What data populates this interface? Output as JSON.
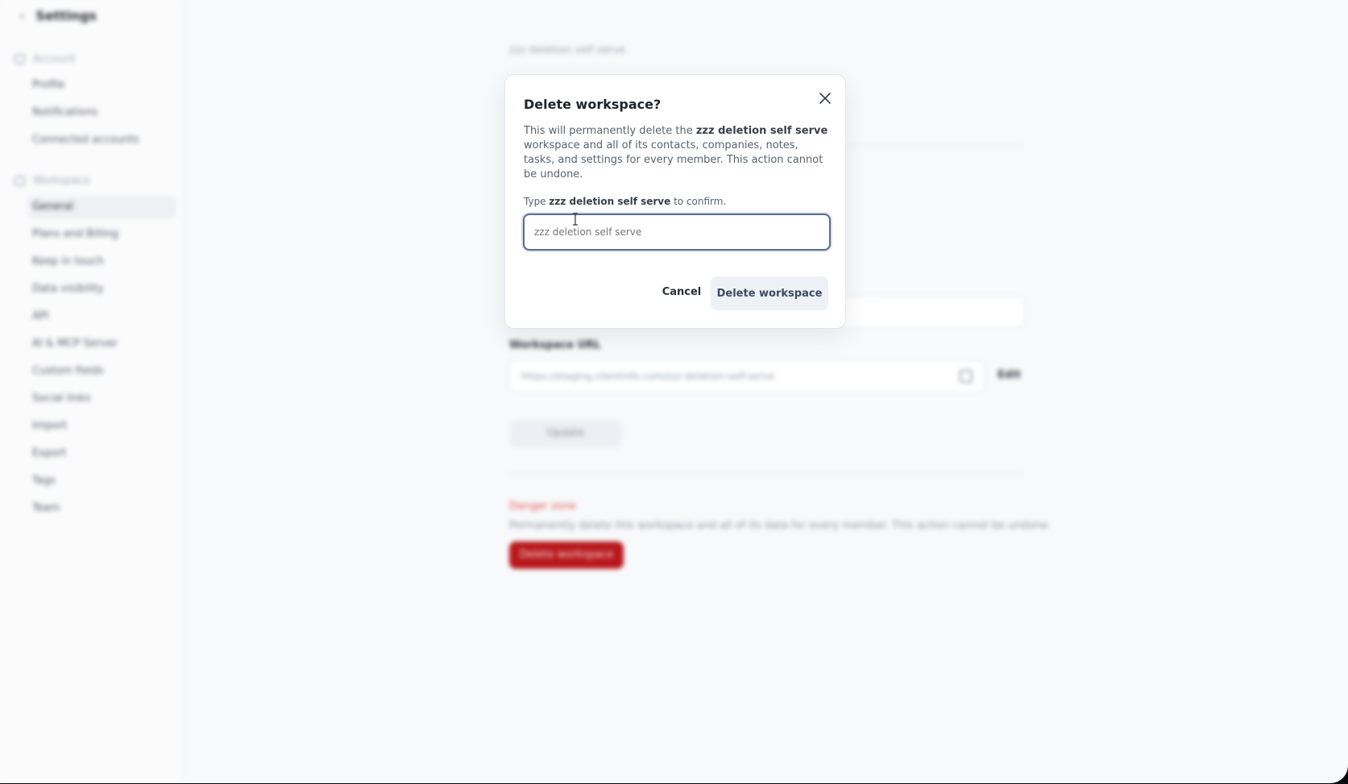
{
  "sidebar": {
    "back_icon": "chevron-left-icon",
    "title": "Settings",
    "account_section": "Account",
    "account_items": [
      "Profile",
      "Notifications",
      "Connected accounts"
    ],
    "workspace_section": "Workspace",
    "workspace_items": [
      "General",
      "Plans and Billing",
      "Keep in touch",
      "Data visibility",
      "API",
      "AI & MCP Server",
      "Custom fields",
      "Social links",
      "Import",
      "Export",
      "Tags",
      "Team"
    ],
    "active_item": "General"
  },
  "main": {
    "workspace_name": "zzz deletion self serve",
    "workspace_url_label": "Workspace URL",
    "workspace_url": "https://staging.clientinfo.com/zzz-deletion-self-serve",
    "edit_label": "Edit",
    "update_label": "Update",
    "danger_title": "Danger zone",
    "danger_desc": "Permanently delete this workspace and all of its data for every member. This action cannot be undone.",
    "delete_label": "Delete workspace"
  },
  "modal": {
    "title": "Delete workspace?",
    "desc_prefix": "This will permanently delete the ",
    "desc_name": "zzz deletion self serve",
    "desc_suffix": " workspace and all of its contacts, companies, notes, tasks, and settings for every member. This action cannot be undone.",
    "confirm_prefix": "Type ",
    "confirm_name": "zzz deletion self serve",
    "confirm_suffix": " to confirm.",
    "input_placeholder": "zzz deletion self serve",
    "cancel_label": "Cancel",
    "delete_label": "Delete workspace"
  },
  "colors": {
    "danger": "#b8181c",
    "focus_border": "#5a6b8c"
  }
}
